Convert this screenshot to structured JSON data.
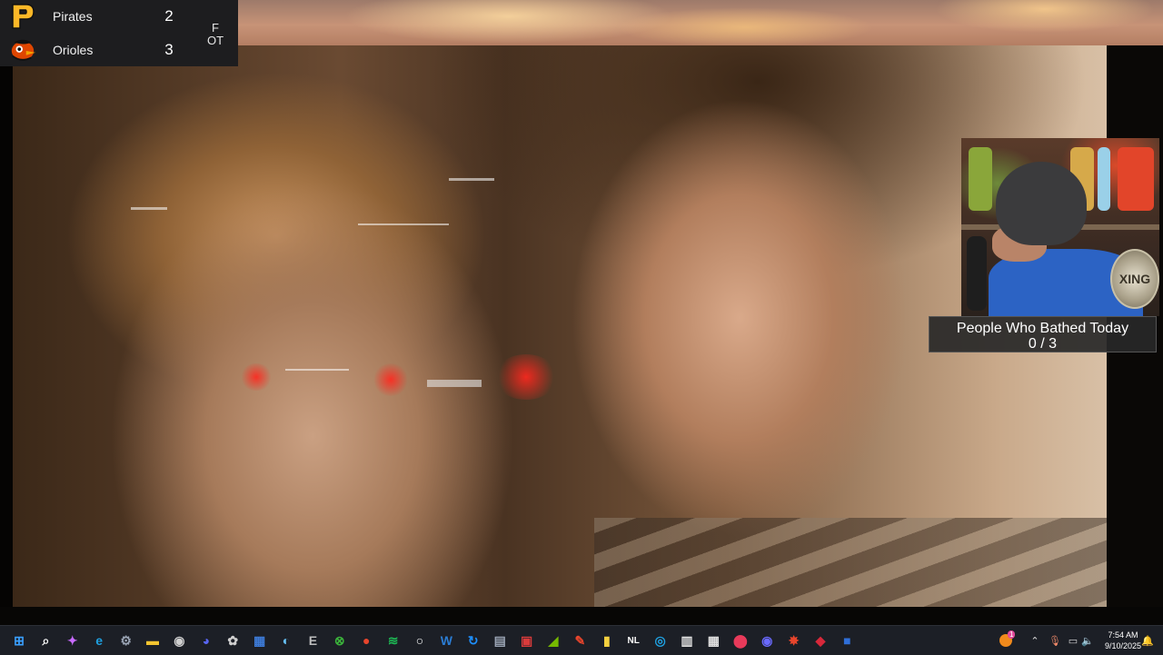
{
  "scoreboard": {
    "teams": [
      {
        "name": "Pirates",
        "score": "2",
        "logo_icon": "pirates-p-logo-icon",
        "logo_color": "#fdb827"
      },
      {
        "name": "Orioles",
        "score": "3",
        "logo_icon": "orioles-bird-logo-icon",
        "logo_color": "#df4601"
      }
    ],
    "status_line1": "F",
    "status_line2": "OT"
  },
  "counter": {
    "title": "People Who Bathed Today",
    "value": "0 / 3"
  },
  "webcam": {
    "badge_text": "XING"
  },
  "taskbar": {
    "icons": [
      {
        "name": "windows-start-icon",
        "glyph": "⊞",
        "color": "#3aa0ff"
      },
      {
        "name": "search-icon",
        "glyph": "⌕",
        "color": "#ffffff"
      },
      {
        "name": "copilot-icon",
        "glyph": "✦",
        "color": "#c86bff"
      },
      {
        "name": "edge-icon",
        "glyph": "e",
        "color": "#1fa0e0"
      },
      {
        "name": "settings-gear-icon",
        "glyph": "⚙",
        "color": "#9aa4b4"
      },
      {
        "name": "file-explorer-icon",
        "glyph": "▬",
        "color": "#f4c430"
      },
      {
        "name": "obs-icon",
        "glyph": "◉",
        "color": "#cfcfcf"
      },
      {
        "name": "discord-icon",
        "glyph": "◕",
        "color": "#5865f2"
      },
      {
        "name": "chatgpt-icon",
        "glyph": "✿",
        "color": "#cfcfcf"
      },
      {
        "name": "app-tile-icon",
        "glyph": "▦",
        "color": "#3d7bd8"
      },
      {
        "name": "steam-icon",
        "glyph": "◐",
        "color": "#66c0f4"
      },
      {
        "name": "epic-games-icon",
        "glyph": "E",
        "color": "#bdbdbd"
      },
      {
        "name": "xbox-icon",
        "glyph": "⊗",
        "color": "#3bb33b"
      },
      {
        "name": "record-icon",
        "glyph": "●",
        "color": "#e8452c"
      },
      {
        "name": "spotify-icon",
        "glyph": "≋",
        "color": "#1db954"
      },
      {
        "name": "circle-app-icon",
        "glyph": "○",
        "color": "#ffffff"
      },
      {
        "name": "word-icon",
        "glyph": "W",
        "color": "#2b7cd3"
      },
      {
        "name": "refresh-app-icon",
        "glyph": "↻",
        "color": "#1e90ff"
      },
      {
        "name": "calculator-icon",
        "glyph": "▤",
        "color": "#9aa4b4"
      },
      {
        "name": "image-editor-icon",
        "glyph": "▣",
        "color": "#d83b3b"
      },
      {
        "name": "nvidia-icon",
        "glyph": "◢",
        "color": "#76b900"
      },
      {
        "name": "pen-app-icon",
        "glyph": "✎",
        "color": "#e8452c"
      },
      {
        "name": "sticky-notes-icon",
        "glyph": "▮",
        "color": "#f4d03f"
      },
      {
        "name": "nl-app-icon",
        "glyph": "NL",
        "color": "#ffffff"
      },
      {
        "name": "blue-swirl-icon",
        "glyph": "◎",
        "color": "#1fa0e0"
      },
      {
        "name": "store-bag-icon",
        "glyph": "▥",
        "color": "#e0e0e0"
      },
      {
        "name": "ms-store-icon",
        "glyph": "▦",
        "color": "#e0e0e0"
      },
      {
        "name": "map-pin-icon",
        "glyph": "⬤",
        "color": "#e83a5a"
      },
      {
        "name": "media-app-icon",
        "glyph": "◉",
        "color": "#6a6aff"
      },
      {
        "name": "starburst-icon",
        "glyph": "✸",
        "color": "#e8452c"
      },
      {
        "name": "drop-app-icon",
        "glyph": "◆",
        "color": "#d8283a"
      },
      {
        "name": "active-window-icon",
        "glyph": "■",
        "color": "#2f6fd8"
      }
    ]
  },
  "tray": {
    "notification_badge": "1",
    "time": "7:54 AM",
    "date": "9/10/2025"
  }
}
